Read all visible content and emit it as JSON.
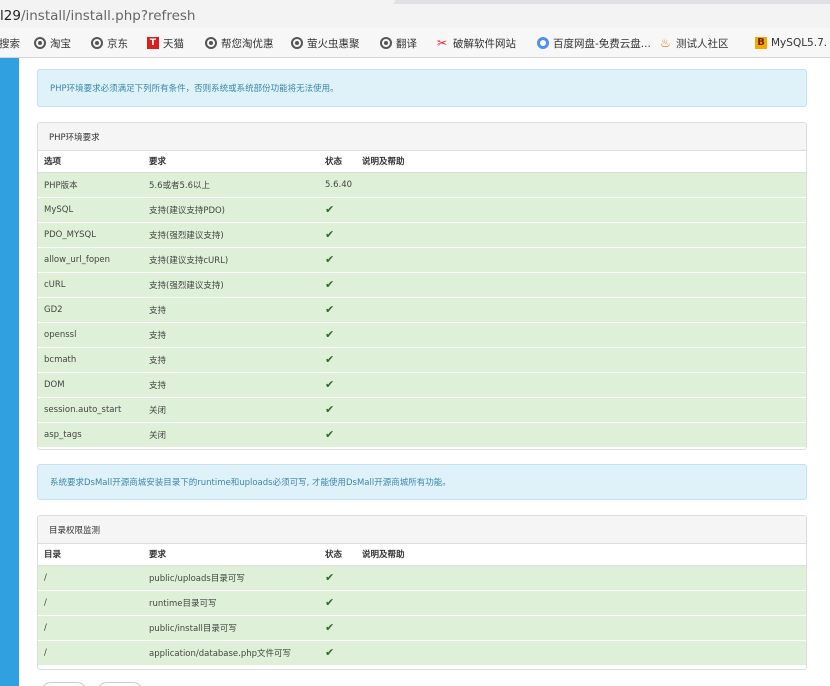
{
  "browser": {
    "url_prefix": "l29",
    "url_path": "/install/install.php?refresh",
    "bookmarks": [
      {
        "label": "搜索",
        "icon": "none"
      },
      {
        "label": "淘宝",
        "icon": "globe-icon"
      },
      {
        "label": "京东",
        "icon": "globe-icon"
      },
      {
        "label": "天猫",
        "icon": "tmall-icon"
      },
      {
        "label": "帮您淘优惠",
        "icon": "globe-icon"
      },
      {
        "label": "萤火虫惠聚",
        "icon": "globe-icon"
      },
      {
        "label": "翻译",
        "icon": "globe-icon"
      },
      {
        "label": "破解软件网站",
        "icon": "crack-icon"
      },
      {
        "label": "百度网盘-免费云盘...",
        "icon": "baidu-icon"
      },
      {
        "label": "测试人社区",
        "icon": "java-icon"
      },
      {
        "label": "MySQL5.7.",
        "icon": "mysql-icon"
      }
    ]
  },
  "notice1": "PHP环境要求必须满足下列所有条件，否则系统或系统部份功能将无法使用。",
  "env_panel": {
    "title": "PHP环境要求",
    "headers": [
      "选项",
      "要求",
      "状态",
      "说明及帮助"
    ],
    "rows": [
      {
        "name": "PHP版本",
        "req": "5.6或者5.6以上",
        "status": "5.6.40",
        "help": ""
      },
      {
        "name": "MySQL",
        "req": "支持(建议支持PDO)",
        "status": "✔",
        "help": ""
      },
      {
        "name": "PDO_MYSQL",
        "req": "支持(强烈建议支持)",
        "status": "✔",
        "help": ""
      },
      {
        "name": "allow_url_fopen",
        "req": "支持(建议支持cURL)",
        "status": "✔",
        "help": ""
      },
      {
        "name": "cURL",
        "req": "支持(强烈建议支持)",
        "status": "✔",
        "help": ""
      },
      {
        "name": "GD2",
        "req": "支持",
        "status": "✔",
        "help": ""
      },
      {
        "name": "openssl",
        "req": "支持",
        "status": "✔",
        "help": ""
      },
      {
        "name": "bcmath",
        "req": "支持",
        "status": "✔",
        "help": ""
      },
      {
        "name": "DOM",
        "req": "支持",
        "status": "✔",
        "help": ""
      },
      {
        "name": "session.auto_start",
        "req": "关闭",
        "status": "✔",
        "help": ""
      },
      {
        "name": "asp_tags",
        "req": "关闭",
        "status": "✔",
        "help": ""
      }
    ]
  },
  "notice2": "系统要求DsMall开源商城安装目录下的runtime和uploads必须可写, 才能使用DsMall开源商城所有功能。",
  "dir_panel": {
    "title": "目录权限监测",
    "headers": [
      "目录",
      "要求",
      "状态",
      "说明及帮助"
    ],
    "rows": [
      {
        "name": "/",
        "req": "public/uploads目录可写",
        "status": "✔",
        "help": ""
      },
      {
        "name": "/",
        "req": "runtime目录可写",
        "status": "✔",
        "help": ""
      },
      {
        "name": "/",
        "req": "public/install目录可写",
        "status": "✔",
        "help": ""
      },
      {
        "name": "/",
        "req": "application/database.php文件可写",
        "status": "✔",
        "help": ""
      }
    ]
  },
  "colors": {
    "accent_strip": "#31a0e0",
    "success_row": "#dff0d8",
    "info_bg": "#dff1f9",
    "info_text": "#3a87ad"
  }
}
